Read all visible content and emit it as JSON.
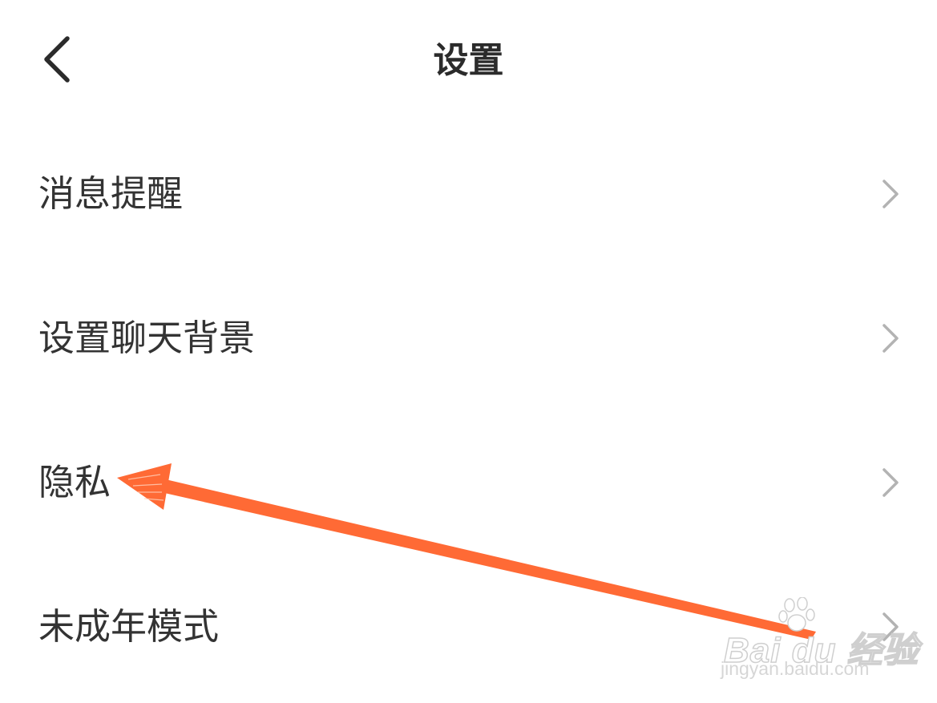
{
  "header": {
    "title": "设置",
    "back_icon": "back-arrow-icon"
  },
  "settings": {
    "items": [
      {
        "label": "消息提醒",
        "icon": "chevron-right-icon"
      },
      {
        "label": "设置聊天背景",
        "icon": "chevron-right-icon"
      },
      {
        "label": "隐私",
        "icon": "chevron-right-icon"
      },
      {
        "label": "未成年模式",
        "icon": "chevron-right-icon"
      }
    ]
  },
  "watermark": {
    "logo_text": "Bai du 经验",
    "url": "jingyan.baidu.com"
  },
  "colors": {
    "text": "#333333",
    "title": "#2b2b2b",
    "chevron": "#b3b3b3",
    "annotation_arrow": "#ff6a35",
    "background": "#ffffff"
  }
}
